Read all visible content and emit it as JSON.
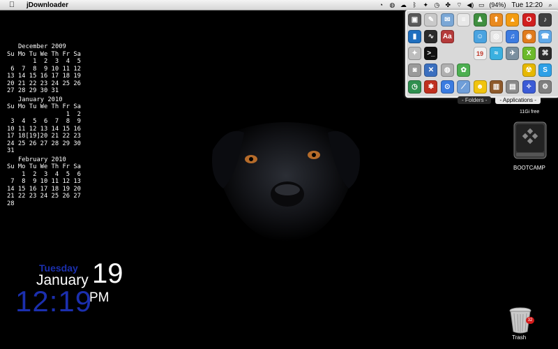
{
  "menubar": {
    "app_name": "jDownloader",
    "battery": "(94%)",
    "clock": "Tue 12:20",
    "icons": [
      "apple-icon",
      "timer-icon",
      "globe-icon",
      "cloud-icon",
      "bluetooth-icon",
      "dropbox-icon",
      "time-machine-icon",
      "growl-icon",
      "wifi-icon",
      "volume-icon",
      "battery-icon",
      "spotlight-icon"
    ]
  },
  "calendar": {
    "months": [
      {
        "title": "December 2009",
        "header": "Su Mo Tu We Th Fr Sa",
        "rows": [
          "       1  2  3  4  5",
          " 6  7  8  9 10 11 12",
          "13 14 15 16 17 18 19",
          "20 21 22 23 24 25 26",
          "27 28 29 30 31"
        ]
      },
      {
        "title": "January 2010",
        "header": "Su Mo Tu We Th Fr Sa",
        "rows": [
          "                1  2",
          " 3  4  5  6  7  8  9",
          "10 11 12 13 14 15 16",
          "17 18[19]20 21 22 23",
          "24 25 26 27 28 29 30",
          "31"
        ]
      },
      {
        "title": "February 2010",
        "header": "Su Mo Tu We Th Fr Sa",
        "rows": [
          "    1  2  3  4  5  6",
          " 7  8  9 10 11 12 13",
          "14 15 16 17 18 19 20",
          "21 22 23 24 25 26 27",
          "28"
        ]
      }
    ]
  },
  "date_widget": {
    "weekday": "Tuesday",
    "month": "January",
    "day": "19",
    "time": "12:19",
    "ampm": "PM"
  },
  "stack": {
    "apps": [
      {
        "name": "preview-app-icon",
        "color": "#5a5a5a",
        "glyph": "▣"
      },
      {
        "name": "textedit-app-icon",
        "color": "#c9c9c9",
        "glyph": "✎"
      },
      {
        "name": "mail-app-icon",
        "color": "#7aa7d6",
        "glyph": "✉"
      },
      {
        "name": "script-app-icon",
        "color": "#e8e8e8",
        "glyph": "≡"
      },
      {
        "name": "automator-app-icon",
        "color": "#3f8f3f",
        "glyph": "♟"
      },
      {
        "name": "transmission-app-icon",
        "color": "#e98a1f",
        "glyph": "⬆"
      },
      {
        "name": "vlc-app-icon",
        "color": "#f39c12",
        "glyph": "▲"
      },
      {
        "name": "opera-app-icon",
        "color": "#d11f1f",
        "glyph": "O"
      },
      {
        "name": "audacity-app-icon",
        "color": "#404040",
        "glyph": "♪"
      },
      {
        "name": "utility-app-icon",
        "color": "#1f6fbf",
        "glyph": "▮"
      },
      {
        "name": "activity-monitor-app-icon",
        "color": "#2b2b2b",
        "glyph": "∿"
      },
      {
        "name": "dictionary-app-icon",
        "color": "#b53a3a",
        "glyph": "Aa"
      },
      {
        "name": "empty-slot",
        "color": "#d9d9d9",
        "glyph": ""
      },
      {
        "name": "finder-app-icon",
        "color": "#4aa3e0",
        "glyph": "☺"
      },
      {
        "name": "chrome-app-icon",
        "color": "#e5e5e5",
        "glyph": "◎"
      },
      {
        "name": "itunes-app-icon",
        "color": "#3c7be0",
        "glyph": "♫"
      },
      {
        "name": "firefox-app-icon",
        "color": "#e07b1c",
        "glyph": "◉"
      },
      {
        "name": "ichat-app-icon",
        "color": "#5fa8e8",
        "glyph": "☎"
      },
      {
        "name": "system-info-app-icon",
        "color": "#bdbdbd",
        "glyph": "✦"
      },
      {
        "name": "terminal-app-icon",
        "color": "#111111",
        "glyph": ">_"
      },
      {
        "name": "empty-slot-2",
        "color": "#d9d9d9",
        "glyph": ""
      },
      {
        "name": "empty-slot-3",
        "color": "#d9d9d9",
        "glyph": ""
      },
      {
        "name": "ical-app-icon",
        "color": "#f0f0f0",
        "glyph": "19"
      },
      {
        "name": "fish-app-icon",
        "color": "#3ab0e0",
        "glyph": "≈"
      },
      {
        "name": "twitter-app-icon",
        "color": "#7a8f9f",
        "glyph": "✈"
      },
      {
        "name": "xbox-app-icon",
        "color": "#6cba2b",
        "glyph": "X"
      },
      {
        "name": "network-app-icon",
        "color": "#2a2a2a",
        "glyph": "⌘"
      },
      {
        "name": "camera-app-icon",
        "color": "#9a9a9a",
        "glyph": "◙"
      },
      {
        "name": "xcode-app-icon",
        "color": "#3a6fbf",
        "glyph": "✕"
      },
      {
        "name": "monitor-app-icon",
        "color": "#b0b0b0",
        "glyph": "◍"
      },
      {
        "name": "clover-app-icon",
        "color": "#4caf50",
        "glyph": "✿"
      },
      {
        "name": "empty-slot-4",
        "color": "#d9d9d9",
        "glyph": ""
      },
      {
        "name": "empty-slot-5",
        "color": "#d9d9d9",
        "glyph": ""
      },
      {
        "name": "empty-slot-6",
        "color": "#d9d9d9",
        "glyph": ""
      },
      {
        "name": "radiation-app-icon",
        "color": "#e6b800",
        "glyph": "☢"
      },
      {
        "name": "skype-app-icon",
        "color": "#2ea0e6",
        "glyph": "S"
      },
      {
        "name": "time-machine-app-icon",
        "color": "#2f8f4f",
        "glyph": "◷"
      },
      {
        "name": "red-app-icon",
        "color": "#c0301f",
        "glyph": "✱"
      },
      {
        "name": "safari-app-icon",
        "color": "#3a7be0",
        "glyph": "⊙"
      },
      {
        "name": "feather-app-icon",
        "color": "#6f9ed8",
        "glyph": "⟋"
      },
      {
        "name": "adium-app-icon",
        "color": "#f1c40f",
        "glyph": "☻"
      },
      {
        "name": "books-app-icon",
        "color": "#8e5a2b",
        "glyph": "▥"
      },
      {
        "name": "photo-app-icon",
        "color": "#8a8a8a",
        "glyph": "▤"
      },
      {
        "name": "compass-app-icon",
        "color": "#3b5bd6",
        "glyph": "✧"
      },
      {
        "name": "sys-pref-app-icon",
        "color": "#7f7f7f",
        "glyph": "⚙"
      }
    ]
  },
  "stack_tabs": {
    "folders": "Folders",
    "applications": "Applications"
  },
  "bootcamp": {
    "free": "11Gi free",
    "label": "BOOTCAMP"
  },
  "trash": {
    "label": "Trash",
    "badge": "32"
  }
}
